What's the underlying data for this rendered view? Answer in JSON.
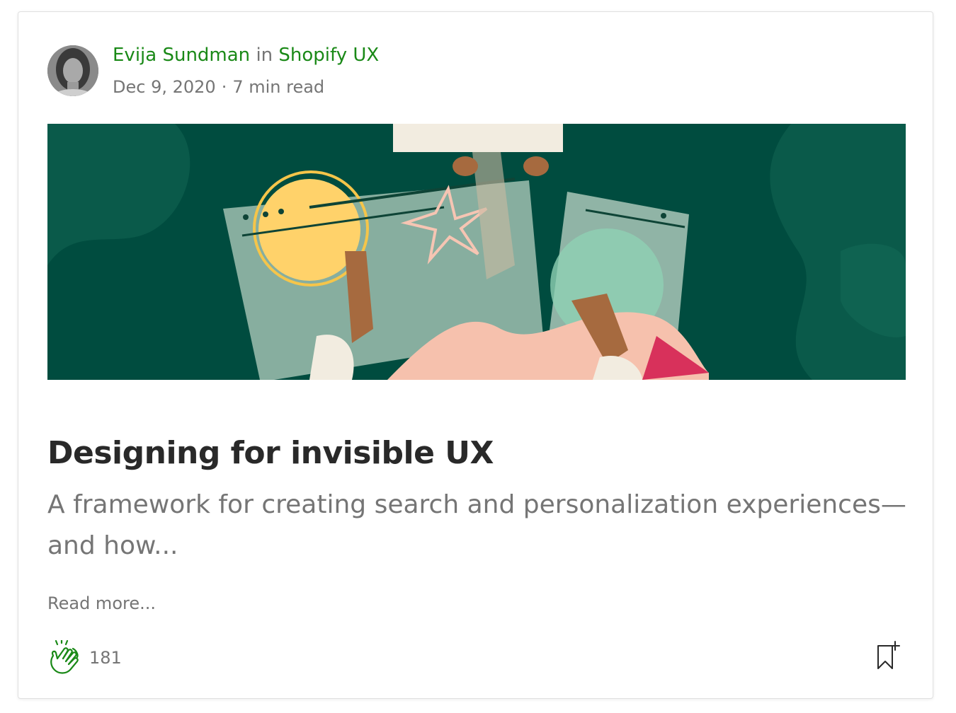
{
  "post": {
    "author": "Evija Sundman",
    "in_word": "in",
    "publication": "Shopify UX",
    "date": "Dec 9, 2020",
    "separator": "·",
    "read_time": "7 min read",
    "title": "Designing for invisible UX",
    "subtitle": "A framework for creating search and personalization experiences—and how...",
    "read_more": "Read more...",
    "claps": "181"
  },
  "icons": {
    "clap": "clap-icon",
    "bookmark": "bookmark-add-icon"
  },
  "colors": {
    "accent_green": "#1a8917",
    "text_dark": "#292929",
    "text_muted": "#757575",
    "hero_bg": "#004c3f"
  }
}
